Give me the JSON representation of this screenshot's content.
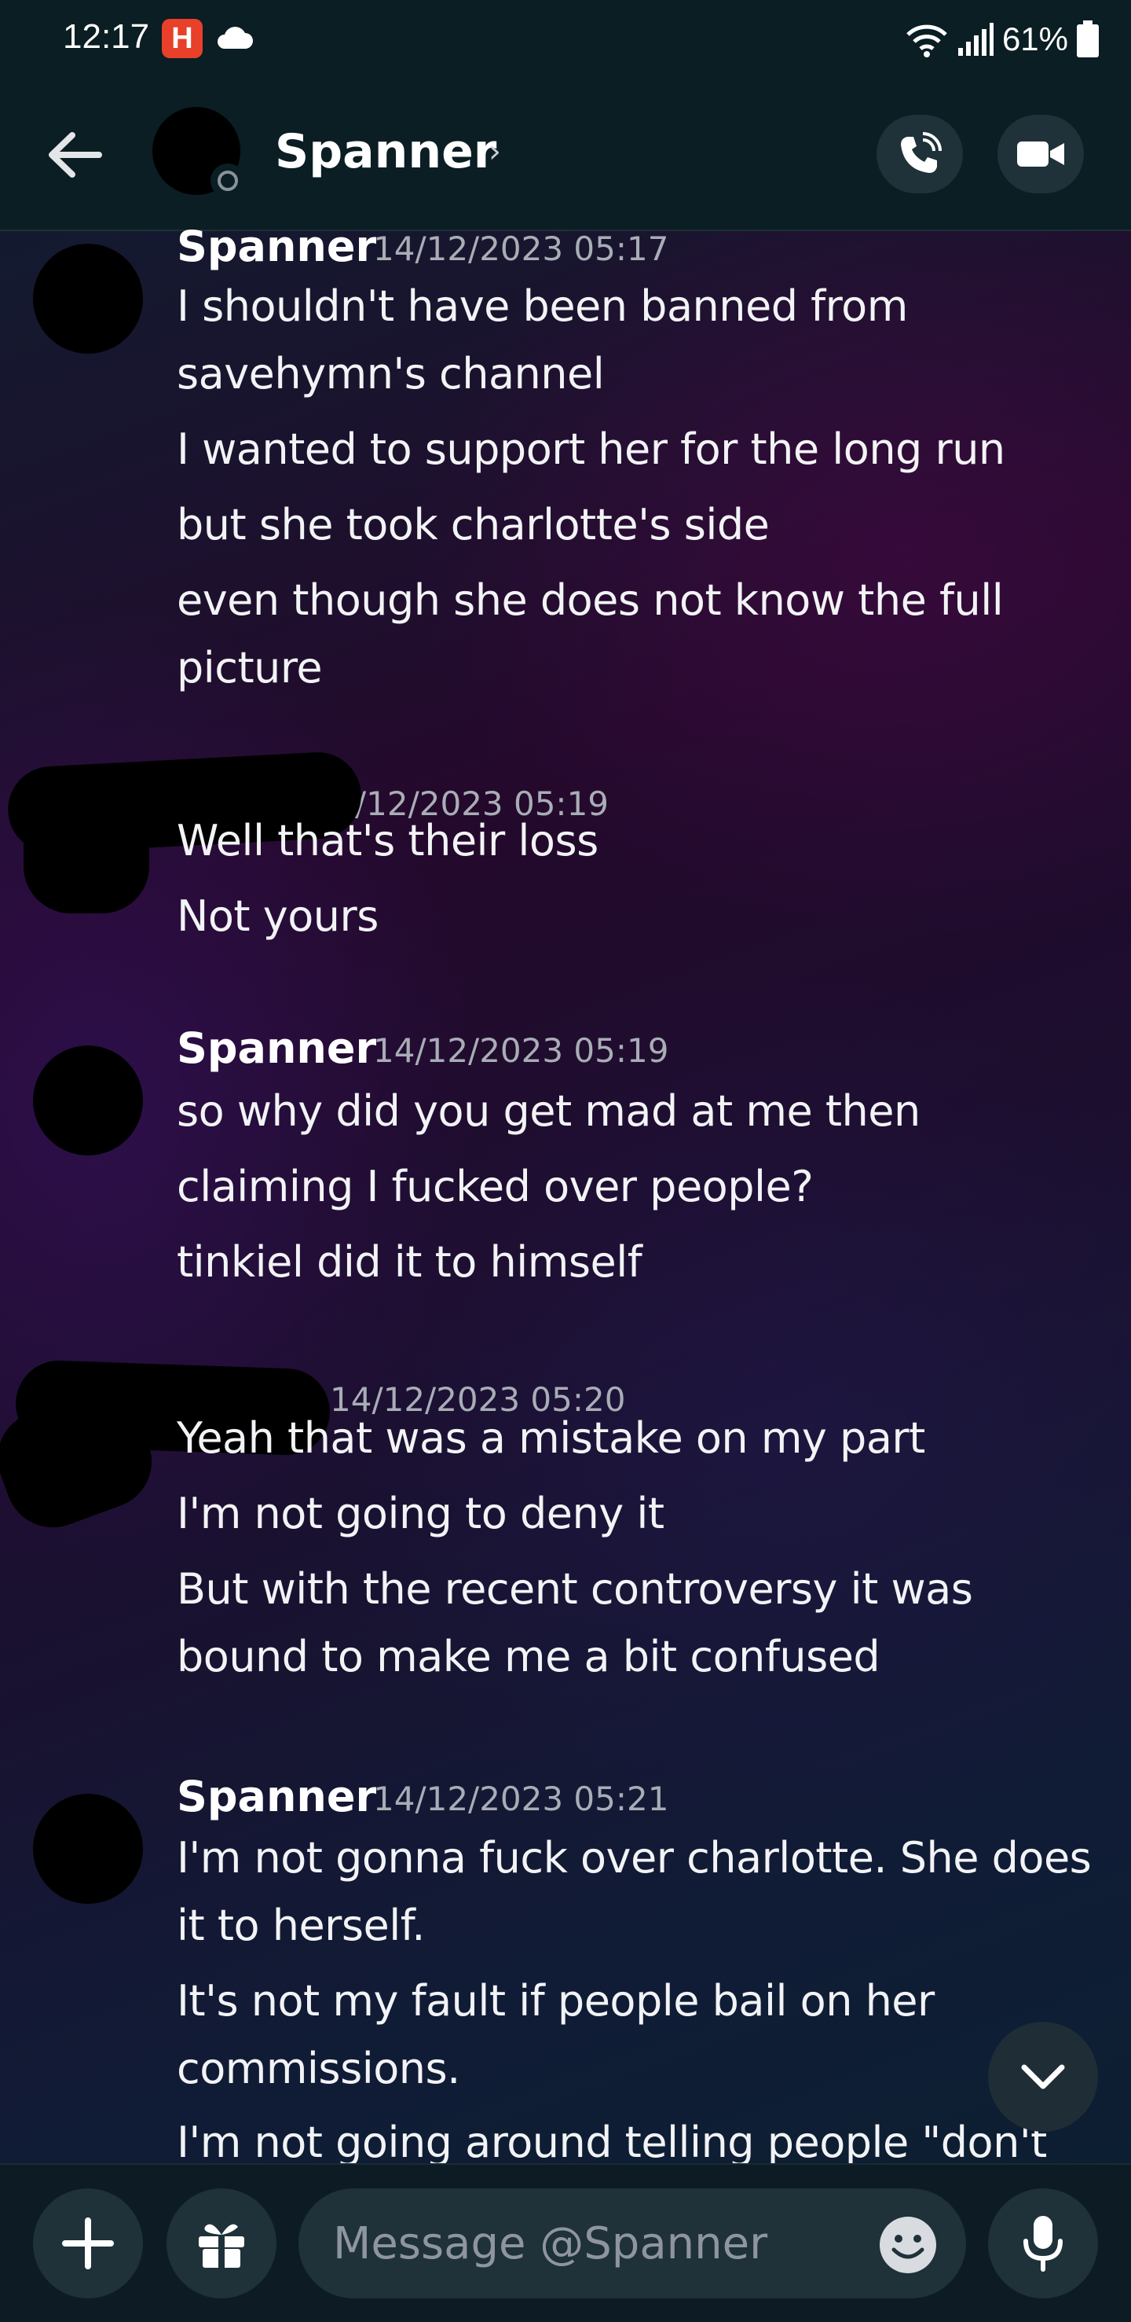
{
  "status_bar": {
    "time": "12:17",
    "notification_badge": "H",
    "battery": "61%"
  },
  "header": {
    "name": "Spanner",
    "chevron": "›",
    "back_icon": "arrow-left-icon",
    "call_icon": "phone-call-icon",
    "video_icon": "video-camera-icon"
  },
  "messages": [
    {
      "author": "Spanner",
      "timestamp": "14/12/2023 05:17",
      "lines": [
        "I shouldn't have been banned from",
        "savehymn's channel",
        "I wanted to support her for the long run",
        "but she took charlotte's side",
        "even though she does not know the full",
        "picture"
      ]
    },
    {
      "author": "",
      "timestamp": "/12/2023 05:19",
      "lines": [
        "Well that's their loss",
        "Not yours"
      ]
    },
    {
      "author": "Spanner",
      "timestamp": "14/12/2023 05:19",
      "lines": [
        "so why did you get mad at me then",
        "claiming I fucked over people?",
        "tinkiel did it to himself"
      ]
    },
    {
      "author": "",
      "timestamp": "14/12/2023 05:20",
      "lines": [
        "Yeah that was a mistake on my part",
        "I'm not going to deny it",
        "But with the recent controversy it was",
        "bound to make me a bit confused"
      ]
    },
    {
      "author": "Spanner",
      "timestamp": "14/12/2023 05:21",
      "lines": [
        "I'm not gonna fuck over charlotte. She does",
        "it to herself.",
        "It's not my fault if people bail on her",
        "commissions.",
        "I'm not going around telling people \"don't"
      ]
    }
  ],
  "composer": {
    "placeholder": "Message @Spanner",
    "add_icon": "plus-icon",
    "gift_icon": "gift-icon",
    "emoji_icon": "emoji-icon",
    "mic_icon": "microphone-icon"
  },
  "scroll_down_icon": "chevron-down-icon"
}
